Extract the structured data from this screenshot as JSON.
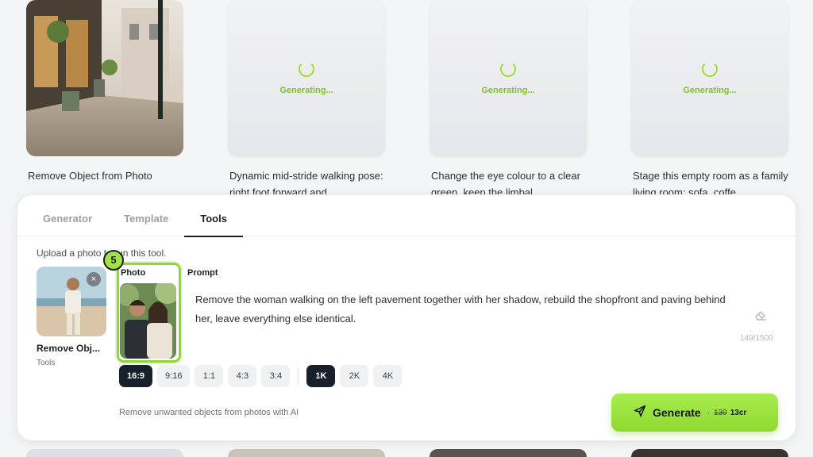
{
  "gallery": {
    "cards": [
      {
        "status": "done",
        "caption": "Remove Object from Photo"
      },
      {
        "status": "generating",
        "status_text": "Generating...",
        "caption": "Dynamic mid-stride walking pose: right foot forward and ..."
      },
      {
        "status": "generating",
        "status_text": "Generating...",
        "caption": "Change the eye colour to a clear green, keep the limbal..."
      },
      {
        "status": "generating",
        "status_text": "Generating...",
        "caption": "Stage this empty room as a family living room: sofa, coffe..."
      }
    ]
  },
  "panel": {
    "tabs": [
      {
        "label": "Generator",
        "active": false
      },
      {
        "label": "Template",
        "active": false
      },
      {
        "label": "Tools",
        "active": true
      }
    ],
    "hint": "Upload a photo to run this tool.",
    "tool": {
      "name": "Remove Obj...",
      "category": "Tools",
      "close_icon": "×"
    },
    "step_badge": "5",
    "photo_label": "Photo",
    "prompt_label": "Prompt",
    "prompt_text": "Remove the woman walking on the left pavement together with her shadow, rebuild the shopfront and paving behind her, leave everything else identical.",
    "char_counter": "149/1500",
    "aspect_ratios": [
      {
        "label": "16:9",
        "selected": true
      },
      {
        "label": "9:16",
        "selected": false
      },
      {
        "label": "1:1",
        "selected": false
      },
      {
        "label": "4:3",
        "selected": false
      },
      {
        "label": "3:4",
        "selected": false
      }
    ],
    "resolutions": [
      {
        "label": "1K",
        "selected": true
      },
      {
        "label": "2K",
        "selected": false
      },
      {
        "label": "4K",
        "selected": false
      }
    ],
    "footer_hint": "Remove unwanted objects from photos with AI",
    "generate": {
      "label": "Generate",
      "separator": "·",
      "old_price": "130",
      "new_price": "13cr"
    }
  },
  "colors": {
    "accent": "#8fd63a",
    "dark": "#17202b",
    "generating_text": "#7cc42a"
  }
}
